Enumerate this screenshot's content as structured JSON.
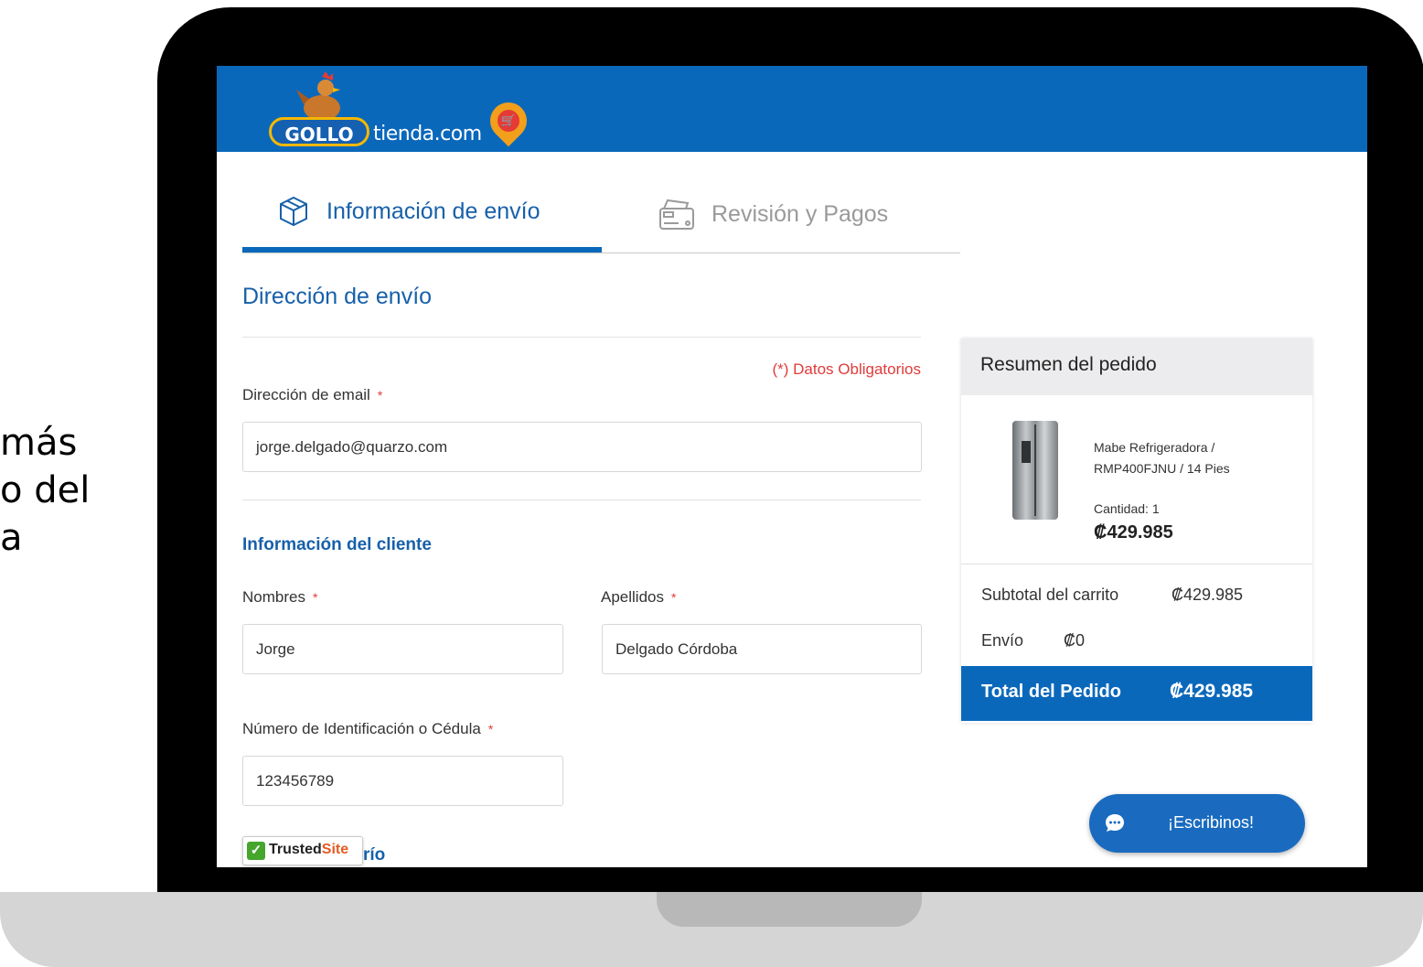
{
  "side_text": [
    "más",
    "o del",
    "a"
  ],
  "header": {
    "logo_brand": "GOLLO",
    "logo_domain": "tienda.com"
  },
  "tabs": [
    {
      "label": "Información de envío",
      "icon": "box-icon",
      "active": true
    },
    {
      "label": "Revisión y Pagos",
      "icon": "credit-card-icon",
      "active": false
    }
  ],
  "form": {
    "section_title": "Dirección de envío",
    "required_note": "(*) Datos Obligatorios",
    "required_marker": "*",
    "email_label": "Dirección de email",
    "email_value": "jorge.delgado@quarzo.com",
    "customer_info_title": "Información del cliente",
    "first_name_label": "Nombres",
    "first_name_value": "Jorge",
    "last_name_label": "Apellidos",
    "last_name_value": "Delgado Córdoba",
    "id_label": "Número de Identificación o Cédula",
    "id_value": "123456789",
    "cut_section_title": "río"
  },
  "summary": {
    "title": "Resumen del pedido",
    "product_name": "Mabe Refrigeradora / RMP400FJNU / 14 Pies",
    "quantity": "Cantidad: 1",
    "price": "₡429.985",
    "subtotal_label": "Subtotal del carrito",
    "subtotal_value": "₡429.985",
    "shipping_label": "Envío",
    "shipping_value": "₡0",
    "total_label": "Total del Pedido",
    "total_value": "₡429.985"
  },
  "chat": {
    "label": "¡Escribinos!",
    "icon": "chat-bubble-icon"
  },
  "trusted": {
    "text_a": "Trusted",
    "text_b": "Site",
    "mark": "✓"
  },
  "colors": {
    "brand_blue": "#0a68bb",
    "required_red": "#e23a3a",
    "logo_yellow": "#f5b800"
  }
}
